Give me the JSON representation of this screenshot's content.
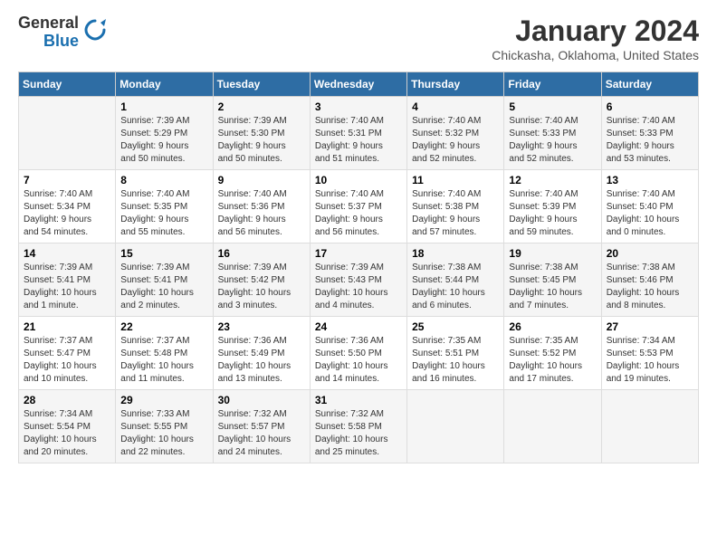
{
  "header": {
    "logo_general": "General",
    "logo_blue": "Blue",
    "title": "January 2024",
    "location": "Chickasha, Oklahoma, United States"
  },
  "days_of_week": [
    "Sunday",
    "Monday",
    "Tuesday",
    "Wednesday",
    "Thursday",
    "Friday",
    "Saturday"
  ],
  "weeks": [
    [
      {
        "day": "",
        "info": ""
      },
      {
        "day": "1",
        "info": "Sunrise: 7:39 AM\nSunset: 5:29 PM\nDaylight: 9 hours\nand 50 minutes."
      },
      {
        "day": "2",
        "info": "Sunrise: 7:39 AM\nSunset: 5:30 PM\nDaylight: 9 hours\nand 50 minutes."
      },
      {
        "day": "3",
        "info": "Sunrise: 7:40 AM\nSunset: 5:31 PM\nDaylight: 9 hours\nand 51 minutes."
      },
      {
        "day": "4",
        "info": "Sunrise: 7:40 AM\nSunset: 5:32 PM\nDaylight: 9 hours\nand 52 minutes."
      },
      {
        "day": "5",
        "info": "Sunrise: 7:40 AM\nSunset: 5:33 PM\nDaylight: 9 hours\nand 52 minutes."
      },
      {
        "day": "6",
        "info": "Sunrise: 7:40 AM\nSunset: 5:33 PM\nDaylight: 9 hours\nand 53 minutes."
      }
    ],
    [
      {
        "day": "7",
        "info": "Sunrise: 7:40 AM\nSunset: 5:34 PM\nDaylight: 9 hours\nand 54 minutes."
      },
      {
        "day": "8",
        "info": "Sunrise: 7:40 AM\nSunset: 5:35 PM\nDaylight: 9 hours\nand 55 minutes."
      },
      {
        "day": "9",
        "info": "Sunrise: 7:40 AM\nSunset: 5:36 PM\nDaylight: 9 hours\nand 56 minutes."
      },
      {
        "day": "10",
        "info": "Sunrise: 7:40 AM\nSunset: 5:37 PM\nDaylight: 9 hours\nand 56 minutes."
      },
      {
        "day": "11",
        "info": "Sunrise: 7:40 AM\nSunset: 5:38 PM\nDaylight: 9 hours\nand 57 minutes."
      },
      {
        "day": "12",
        "info": "Sunrise: 7:40 AM\nSunset: 5:39 PM\nDaylight: 9 hours\nand 59 minutes."
      },
      {
        "day": "13",
        "info": "Sunrise: 7:40 AM\nSunset: 5:40 PM\nDaylight: 10 hours\nand 0 minutes."
      }
    ],
    [
      {
        "day": "14",
        "info": "Sunrise: 7:39 AM\nSunset: 5:41 PM\nDaylight: 10 hours\nand 1 minute."
      },
      {
        "day": "15",
        "info": "Sunrise: 7:39 AM\nSunset: 5:41 PM\nDaylight: 10 hours\nand 2 minutes."
      },
      {
        "day": "16",
        "info": "Sunrise: 7:39 AM\nSunset: 5:42 PM\nDaylight: 10 hours\nand 3 minutes."
      },
      {
        "day": "17",
        "info": "Sunrise: 7:39 AM\nSunset: 5:43 PM\nDaylight: 10 hours\nand 4 minutes."
      },
      {
        "day": "18",
        "info": "Sunrise: 7:38 AM\nSunset: 5:44 PM\nDaylight: 10 hours\nand 6 minutes."
      },
      {
        "day": "19",
        "info": "Sunrise: 7:38 AM\nSunset: 5:45 PM\nDaylight: 10 hours\nand 7 minutes."
      },
      {
        "day": "20",
        "info": "Sunrise: 7:38 AM\nSunset: 5:46 PM\nDaylight: 10 hours\nand 8 minutes."
      }
    ],
    [
      {
        "day": "21",
        "info": "Sunrise: 7:37 AM\nSunset: 5:47 PM\nDaylight: 10 hours\nand 10 minutes."
      },
      {
        "day": "22",
        "info": "Sunrise: 7:37 AM\nSunset: 5:48 PM\nDaylight: 10 hours\nand 11 minutes."
      },
      {
        "day": "23",
        "info": "Sunrise: 7:36 AM\nSunset: 5:49 PM\nDaylight: 10 hours\nand 13 minutes."
      },
      {
        "day": "24",
        "info": "Sunrise: 7:36 AM\nSunset: 5:50 PM\nDaylight: 10 hours\nand 14 minutes."
      },
      {
        "day": "25",
        "info": "Sunrise: 7:35 AM\nSunset: 5:51 PM\nDaylight: 10 hours\nand 16 minutes."
      },
      {
        "day": "26",
        "info": "Sunrise: 7:35 AM\nSunset: 5:52 PM\nDaylight: 10 hours\nand 17 minutes."
      },
      {
        "day": "27",
        "info": "Sunrise: 7:34 AM\nSunset: 5:53 PM\nDaylight: 10 hours\nand 19 minutes."
      }
    ],
    [
      {
        "day": "28",
        "info": "Sunrise: 7:34 AM\nSunset: 5:54 PM\nDaylight: 10 hours\nand 20 minutes."
      },
      {
        "day": "29",
        "info": "Sunrise: 7:33 AM\nSunset: 5:55 PM\nDaylight: 10 hours\nand 22 minutes."
      },
      {
        "day": "30",
        "info": "Sunrise: 7:32 AM\nSunset: 5:57 PM\nDaylight: 10 hours\nand 24 minutes."
      },
      {
        "day": "31",
        "info": "Sunrise: 7:32 AM\nSunset: 5:58 PM\nDaylight: 10 hours\nand 25 minutes."
      },
      {
        "day": "",
        "info": ""
      },
      {
        "day": "",
        "info": ""
      },
      {
        "day": "",
        "info": ""
      }
    ]
  ]
}
